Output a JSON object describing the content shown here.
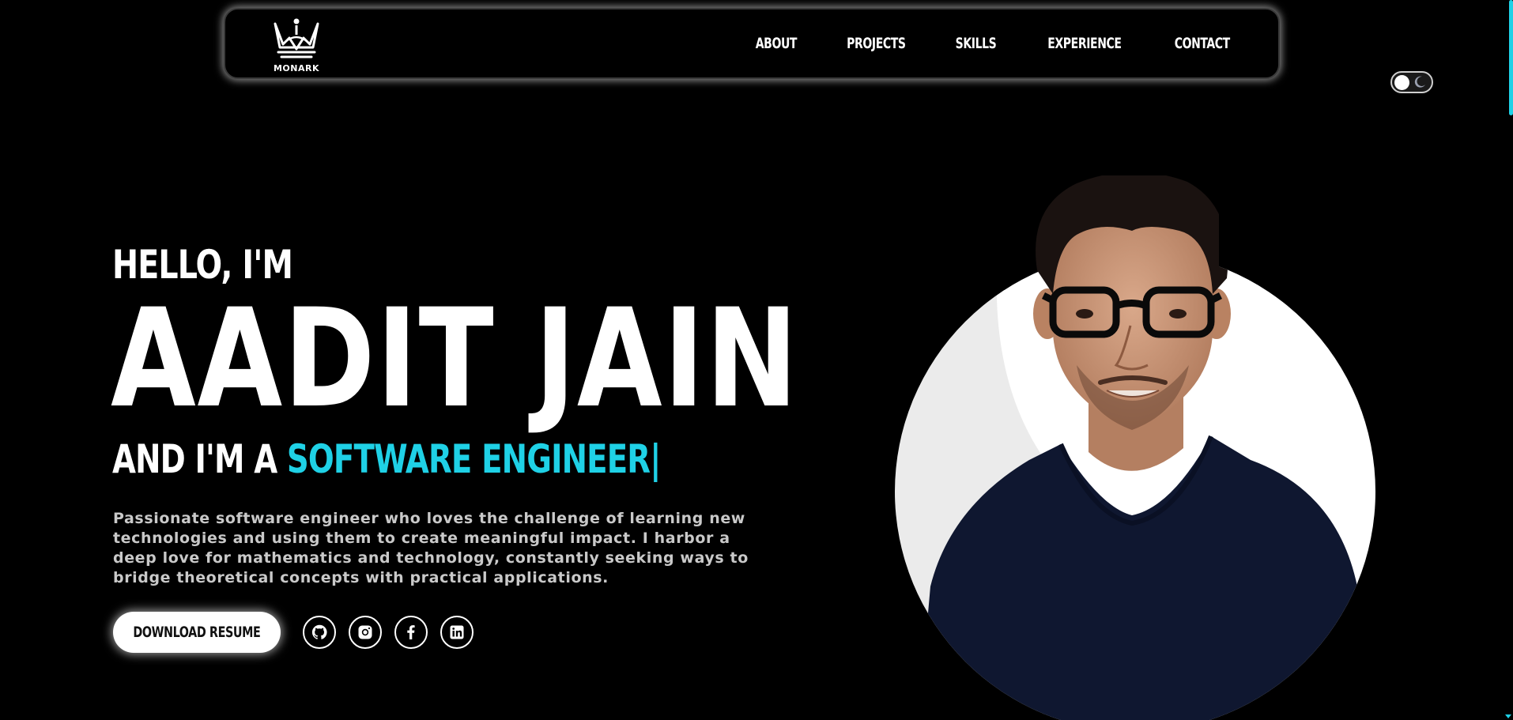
{
  "nav": {
    "logo_text": "MONARK",
    "links": [
      {
        "label": "ABOUT"
      },
      {
        "label": "PROJECTS"
      },
      {
        "label": "SKILLS"
      },
      {
        "label": "EXPERIENCE"
      },
      {
        "label": "CONTACT"
      }
    ]
  },
  "hero": {
    "greeting": "HELLO, I'M",
    "name": "AADIT JAIN",
    "role_prefix": "AND I'M A",
    "role": "SOFTWARE ENGINEER",
    "role_cursor": "|",
    "bio": "Passionate software engineer who loves the challenge of learning new technologies and using them to create meaningful impact. I harbor a deep love for mathematics and technology, constantly seeking ways to bridge theoretical concepts with practical applications.",
    "download_label": "DOWNLOAD RESUME"
  },
  "socials": [
    {
      "icon": "github-icon"
    },
    {
      "icon": "instagram-icon"
    },
    {
      "icon": "facebook-icon"
    },
    {
      "icon": "linkedin-icon"
    }
  ],
  "colors": {
    "background": "#000000",
    "accent": "#1fd1e6",
    "text": "#ffffff",
    "muted_text": "#c9c9c9"
  }
}
